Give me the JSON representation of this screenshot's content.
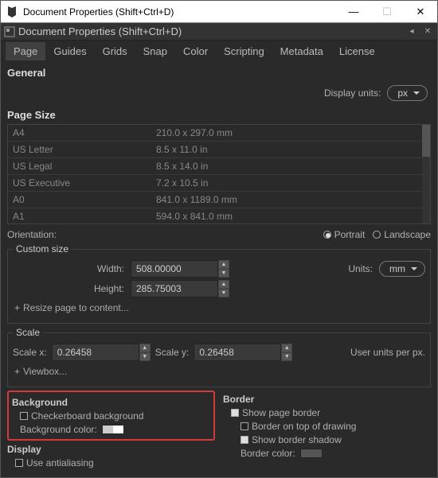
{
  "window": {
    "title": "Document Properties (Shift+Ctrl+D)",
    "subtitle": "Document Properties (Shift+Ctrl+D)"
  },
  "tabs": [
    "Page",
    "Guides",
    "Grids",
    "Snap",
    "Color",
    "Scripting",
    "Metadata",
    "License"
  ],
  "active_tab": "Page",
  "general": {
    "heading": "General",
    "display_units_label": "Display units:",
    "display_units_value": "px"
  },
  "page_size": {
    "heading": "Page Size",
    "items": [
      {
        "name": "A4",
        "dim": "210.0 x 297.0 mm"
      },
      {
        "name": "US Letter",
        "dim": "8.5 x 11.0 in"
      },
      {
        "name": "US Legal",
        "dim": "8.5 x 14.0 in"
      },
      {
        "name": "US Executive",
        "dim": "7.2 x 10.5 in"
      },
      {
        "name": "A0",
        "dim": "841.0 x 1189.0 mm"
      },
      {
        "name": "A1",
        "dim": "594.0 x 841.0 mm"
      }
    ]
  },
  "orientation": {
    "label": "Orientation:",
    "portrait": "Portrait",
    "landscape": "Landscape",
    "selected": "Portrait"
  },
  "custom_size": {
    "legend": "Custom size",
    "width_label": "Width:",
    "width_value": "508.00000",
    "height_label": "Height:",
    "height_value": "285.75003",
    "units_label": "Units:",
    "units_value": "mm",
    "resize_label": "Resize page to content..."
  },
  "scale": {
    "legend": "Scale",
    "scale_x_label": "Scale x:",
    "scale_x_value": "0.26458",
    "scale_y_label": "Scale y:",
    "scale_y_value": "0.26458",
    "user_units_label": "User units per px.",
    "viewbox_label": "Viewbox..."
  },
  "background": {
    "heading": "Background",
    "checkerboard_label": "Checkerboard background",
    "checkerboard_checked": false,
    "color_label": "Background color:"
  },
  "display": {
    "heading": "Display",
    "antialias_label": "Use antialiasing",
    "antialias_checked": false
  },
  "border": {
    "heading": "Border",
    "show_border_label": "Show page border",
    "show_border_checked": true,
    "on_top_label": "Border on top of drawing",
    "on_top_checked": false,
    "shadow_label": "Show border shadow",
    "shadow_checked": true,
    "color_label": "Border color:"
  },
  "plus": "+"
}
